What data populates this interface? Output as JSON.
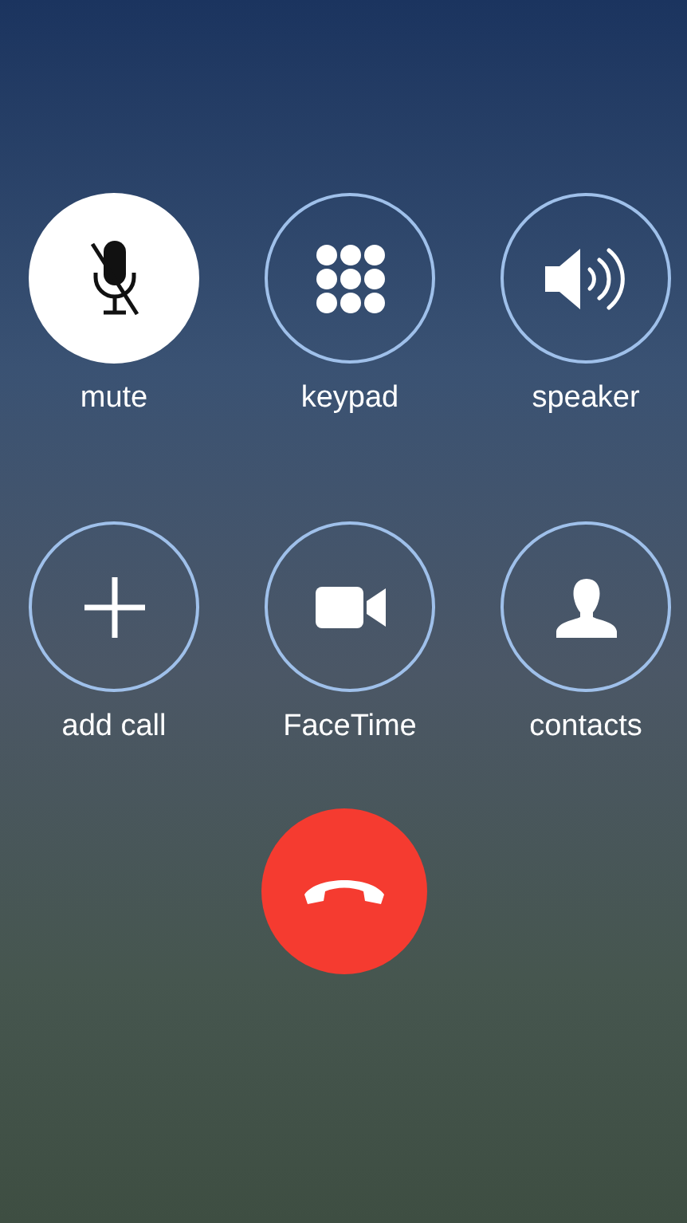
{
  "buttons": [
    {
      "kind": "mute",
      "label": "mute",
      "selected": true
    },
    {
      "kind": "keypad",
      "label": "keypad",
      "selected": false
    },
    {
      "kind": "speaker",
      "label": "speaker",
      "selected": false
    },
    {
      "kind": "add",
      "label": "add call",
      "selected": false
    },
    {
      "kind": "video",
      "label": "FaceTime",
      "selected": false
    },
    {
      "kind": "contacts",
      "label": "contacts",
      "selected": false
    }
  ]
}
